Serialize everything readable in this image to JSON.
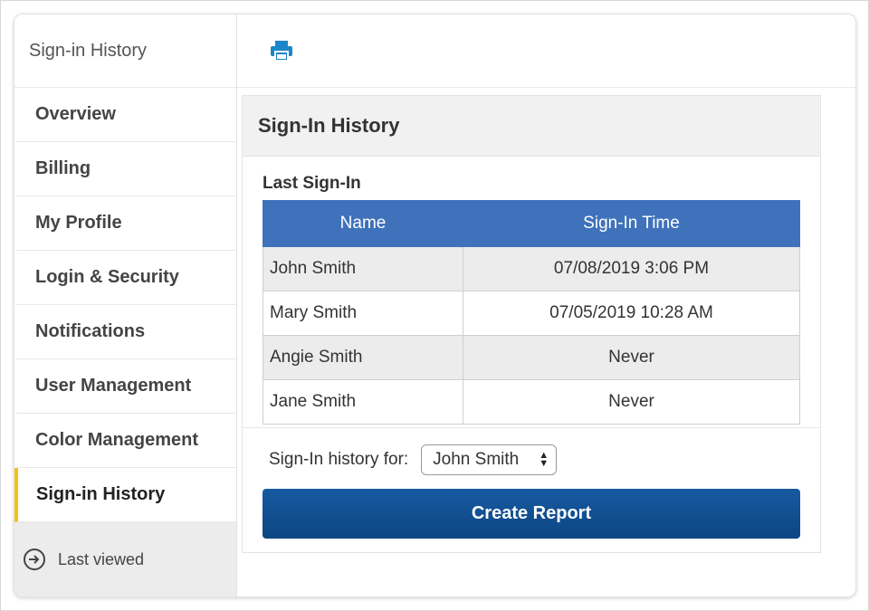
{
  "sidebar": {
    "title": "Sign-in History",
    "items": [
      {
        "label": "Overview"
      },
      {
        "label": "Billing"
      },
      {
        "label": "My Profile"
      },
      {
        "label": "Login & Security"
      },
      {
        "label": "Notifications"
      },
      {
        "label": "User Management"
      },
      {
        "label": "Color Management"
      },
      {
        "label": "Sign-in History",
        "active": true
      }
    ],
    "last_viewed": "Last viewed"
  },
  "toolbar": {
    "print_icon": "print-icon",
    "accent": "#1b86c9"
  },
  "panel": {
    "title": "Sign-In History",
    "subtitle": "Last Sign-In",
    "table": {
      "headers": [
        "Name",
        "Sign-In Time"
      ],
      "rows": [
        {
          "name": "John Smith",
          "time": "07/08/2019 3:06 PM"
        },
        {
          "name": "Mary Smith",
          "time": "07/05/2019 10:28 AM"
        },
        {
          "name": "Angie Smith",
          "time": "Never"
        },
        {
          "name": "Jane Smith",
          "time": "Never"
        }
      ]
    },
    "filter_label": "Sign-In history for:",
    "filter_value": "John Smith",
    "button_label": "Create Report"
  },
  "colors": {
    "header_blue": "#3f72bb",
    "button_blue": "#175aa1",
    "active_marker": "#f2c21b"
  }
}
